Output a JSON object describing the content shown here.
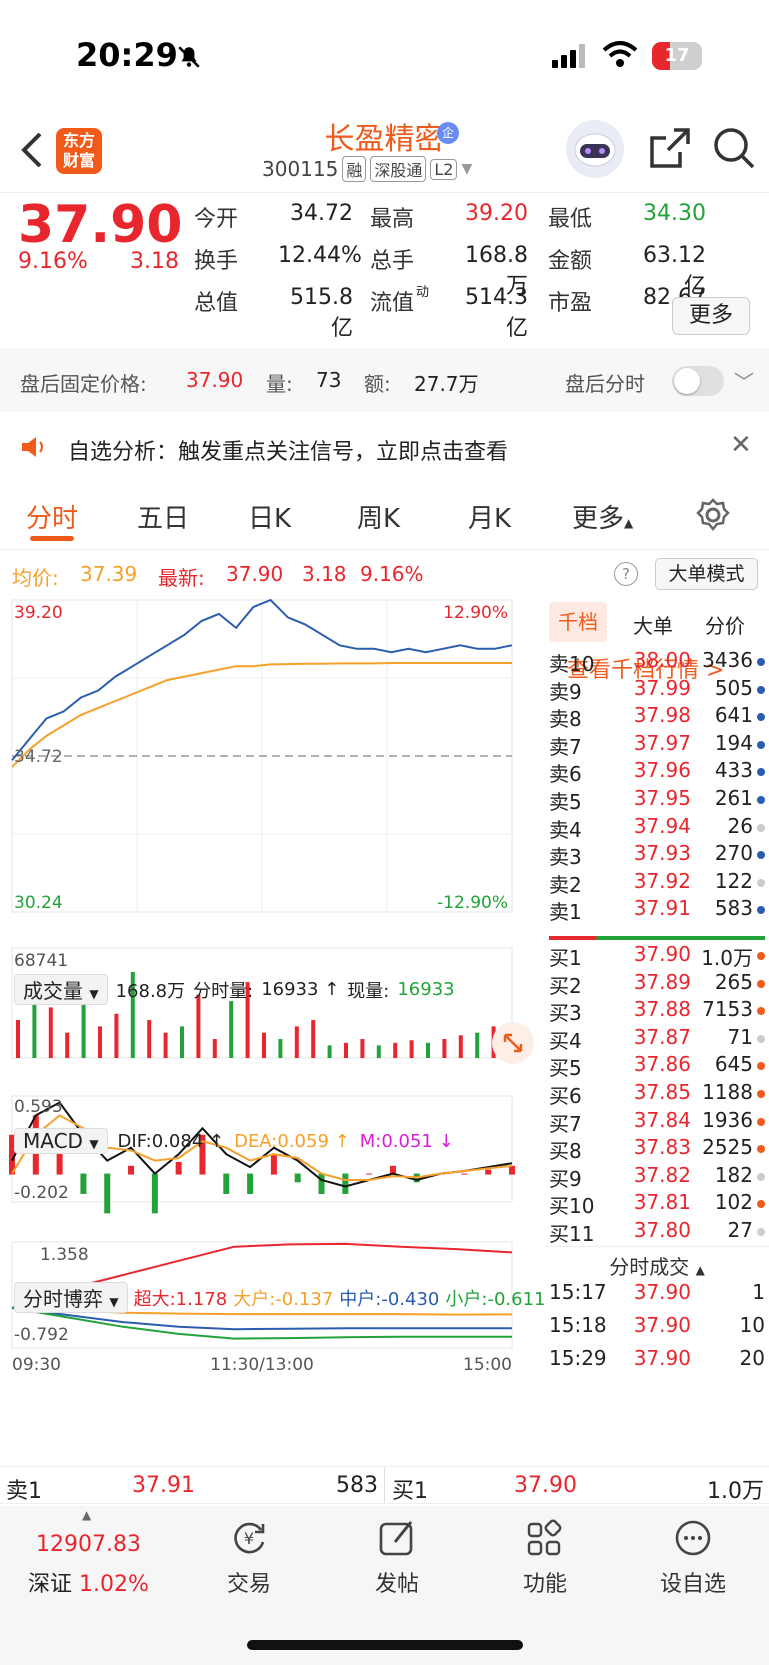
{
  "status": {
    "time": "20:29",
    "battery": "17"
  },
  "header": {
    "logo": "东方财富",
    "name": "长盈精密",
    "corp_badge": "企",
    "code": "300115",
    "tags": [
      "融",
      "深股通",
      "L2"
    ]
  },
  "quote": {
    "price": "37.90",
    "pct": "9.16%",
    "chg": "3.18",
    "fields": [
      {
        "label": "今开",
        "value": "34.72",
        "color": "#222222"
      },
      {
        "label": "最高",
        "value": "39.20",
        "color": "#e8262d"
      },
      {
        "label": "最低",
        "value": "34.30",
        "color": "#22a33a"
      },
      {
        "label": "换手",
        "value": "12.44%",
        "color": "#222222"
      },
      {
        "label": "总手",
        "value": "168.8万",
        "color": "#222222"
      },
      {
        "label": "金额",
        "value": "63.12亿",
        "color": "#222222"
      },
      {
        "label": "总值",
        "value": "515.8亿",
        "color": "#222222"
      },
      {
        "label": "流值",
        "value": "514.3亿",
        "color": "#222222"
      },
      {
        "label": "市盈",
        "value": "82.67",
        "color": "#222222"
      }
    ],
    "pe_sup": "动",
    "more": "更多"
  },
  "after_hours": {
    "label": "盘后固定价格:",
    "price": "37.90",
    "vol_label": "量:",
    "vol": "73",
    "amt_label": "额:",
    "amt": "27.7万",
    "timeshare": "盘后分时"
  },
  "alert": {
    "text": "自选分析：触发重点关注信号，立即点击查看"
  },
  "tabs": [
    "分时",
    "五日",
    "日K",
    "周K",
    "月K",
    "更多"
  ],
  "chart_info": {
    "avg_label": "均价:",
    "avg": "37.39",
    "latest_label": "最新:",
    "latest": "37.90",
    "chg": "3.18",
    "pct": "9.16%",
    "mode": "大单模式"
  },
  "chart_data": [
    {
      "type": "line",
      "title": "分时",
      "y_max": "39.20",
      "y_min": "30.24",
      "pct_max": "12.90%",
      "pct_min": "-12.90%",
      "prev_close": "34.72",
      "x_labels": [
        "09:30",
        "11:30/13:00",
        "15:00"
      ],
      "series": [
        {
          "color": "#2a5db0",
          "values": [
            34.6,
            35.2,
            35.8,
            36.0,
            36.4,
            36.6,
            37.0,
            37.3,
            37.6,
            37.9,
            38.2,
            38.6,
            38.8,
            38.4,
            39.0,
            39.2,
            38.7,
            38.5,
            38.2,
            37.9,
            37.8,
            37.8,
            37.7,
            37.8,
            37.7,
            37.8,
            37.9,
            37.8,
            37.8,
            37.9
          ]
        },
        {
          "color": "#f5a02a",
          "values": [
            34.4,
            34.9,
            35.3,
            35.6,
            35.9,
            36.1,
            36.3,
            36.5,
            36.7,
            36.9,
            37.0,
            37.1,
            37.2,
            37.3,
            37.3,
            37.35,
            37.36,
            37.37,
            37.37,
            37.38,
            37.38,
            37.38,
            37.39,
            37.39,
            37.39,
            37.39,
            37.39,
            37.39,
            37.39,
            37.39
          ]
        }
      ]
    },
    {
      "type": "bar",
      "title": "成交量",
      "max_label": "68741",
      "values": [
        30,
        55,
        40,
        20,
        45,
        25,
        35,
        68,
        30,
        20,
        25,
        50,
        15,
        45,
        60,
        20,
        15,
        25,
        30,
        10,
        12,
        15,
        10,
        12,
        14,
        12,
        15,
        18,
        20,
        25
      ]
    },
    {
      "type": "line",
      "title": "MACD",
      "max_label": "0.593",
      "min_label": "-0.202",
      "series": [
        {
          "name": "DIF",
          "color": "#111111",
          "values": [
            0.1,
            0.45,
            0.55,
            0.3,
            0.1,
            0.2,
            0.0,
            0.15,
            0.35,
            0.15,
            0.05,
            0.2,
            0.1,
            -0.05,
            -0.1,
            -0.05,
            0.0,
            -0.05,
            0.0,
            0.02,
            0.05,
            0.08
          ]
        },
        {
          "name": "DEA",
          "color": "#f5a02a",
          "values": [
            0.0,
            0.3,
            0.45,
            0.35,
            0.2,
            0.18,
            0.1,
            0.12,
            0.25,
            0.2,
            0.1,
            0.15,
            0.12,
            0.0,
            -0.05,
            -0.05,
            -0.02,
            -0.03,
            0.0,
            0.02,
            0.04,
            0.06
          ]
        }
      ]
    },
    {
      "type": "line",
      "title": "分时博弈",
      "max_label": "1.358",
      "min_label": "-0.792",
      "series": [
        {
          "name": "超大",
          "color": "#e8262d",
          "values": [
            0,
            0.4,
            0.7,
            1.0,
            1.3,
            1.35,
            1.36,
            1.3,
            1.25,
            1.18
          ]
        },
        {
          "name": "大户",
          "color": "#f5a02a",
          "values": [
            0,
            -0.05,
            -0.1,
            -0.12,
            -0.13,
            -0.13,
            -0.13,
            -0.13,
            -0.14,
            -0.137
          ]
        },
        {
          "name": "中户",
          "color": "#2a5db0",
          "values": [
            0,
            -0.15,
            -0.3,
            -0.4,
            -0.45,
            -0.44,
            -0.43,
            -0.43,
            -0.43,
            -0.43
          ]
        },
        {
          "name": "小户",
          "color": "#22a33a",
          "values": [
            0,
            -0.2,
            -0.4,
            -0.55,
            -0.65,
            -0.64,
            -0.62,
            -0.61,
            -0.61,
            -0.611
          ]
        }
      ]
    }
  ],
  "volume_hdr": {
    "label": "成交量",
    "total": "168.8万",
    "tick_label": "分时量:",
    "tick": "16933",
    "now_label": "现量:",
    "now": "16933"
  },
  "macd_hdr": {
    "label": "MACD",
    "dif": "DIF:0.084 ↑",
    "dea": "DEA:0.059 ↑",
    "m": "M:0.051 ↓"
  },
  "game_hdr": {
    "label": "分时博弈",
    "super": "超大:1.178",
    "big": "大户:-0.137",
    "mid": "中户:-0.430",
    "small": "小户:-0.611"
  },
  "book": {
    "tabs": [
      "千档",
      "大单",
      "分价"
    ],
    "link": "查看千档行情 >",
    "sells": [
      {
        "n": "卖10",
        "p": "38.00",
        "q": "3436",
        "c": "#2a5db0"
      },
      {
        "n": "卖9",
        "p": "37.99",
        "q": "505",
        "c": "#2a5db0"
      },
      {
        "n": "卖8",
        "p": "37.98",
        "q": "641",
        "c": "#2a5db0"
      },
      {
        "n": "卖7",
        "p": "37.97",
        "q": "194",
        "c": "#2a5db0"
      },
      {
        "n": "卖6",
        "p": "37.96",
        "q": "433",
        "c": "#2a5db0"
      },
      {
        "n": "卖5",
        "p": "37.95",
        "q": "261",
        "c": "#2a5db0"
      },
      {
        "n": "卖4",
        "p": "37.94",
        "q": "26",
        "c": "#cccccc"
      },
      {
        "n": "卖3",
        "p": "37.93",
        "q": "270",
        "c": "#2a5db0"
      },
      {
        "n": "卖2",
        "p": "37.92",
        "q": "122",
        "c": "#cccccc"
      },
      {
        "n": "卖1",
        "p": "37.91",
        "q": "583",
        "c": "#2a5db0"
      }
    ],
    "buys": [
      {
        "n": "买1",
        "p": "37.90",
        "q": "1.0万",
        "c": "#f05a1a"
      },
      {
        "n": "买2",
        "p": "37.89",
        "q": "265",
        "c": "#f05a1a"
      },
      {
        "n": "买3",
        "p": "37.88",
        "q": "7153",
        "c": "#f05a1a"
      },
      {
        "n": "买4",
        "p": "37.87",
        "q": "71",
        "c": "#cccccc"
      },
      {
        "n": "买5",
        "p": "37.86",
        "q": "645",
        "c": "#f05a1a"
      },
      {
        "n": "买6",
        "p": "37.85",
        "q": "1188",
        "c": "#f05a1a"
      },
      {
        "n": "买7",
        "p": "37.84",
        "q": "1936",
        "c": "#f05a1a"
      },
      {
        "n": "买8",
        "p": "37.83",
        "q": "2525",
        "c": "#f05a1a"
      },
      {
        "n": "买9",
        "p": "37.82",
        "q": "182",
        "c": "#cccccc"
      },
      {
        "n": "买10",
        "p": "37.81",
        "q": "102",
        "c": "#f05a1a"
      },
      {
        "n": "买11",
        "p": "37.80",
        "q": "27",
        "c": "#cccccc"
      }
    ],
    "ticks_title": "分时成交",
    "ticks": [
      {
        "t": "15:17",
        "p": "37.90",
        "q": "1"
      },
      {
        "t": "15:18",
        "p": "37.90",
        "q": "10"
      },
      {
        "t": "15:29",
        "p": "37.90",
        "q": "20"
      }
    ]
  },
  "level1": {
    "sell_label": "卖1",
    "sell_p": "37.91",
    "sell_q": "583",
    "buy_label": "买1",
    "buy_p": "37.90",
    "buy_q": "1.0万"
  },
  "bottom": {
    "index_val": "12907.83",
    "index_name": "深证",
    "index_pct": "1.02%",
    "items": [
      "交易",
      "发帖",
      "功能",
      "设自选"
    ]
  }
}
